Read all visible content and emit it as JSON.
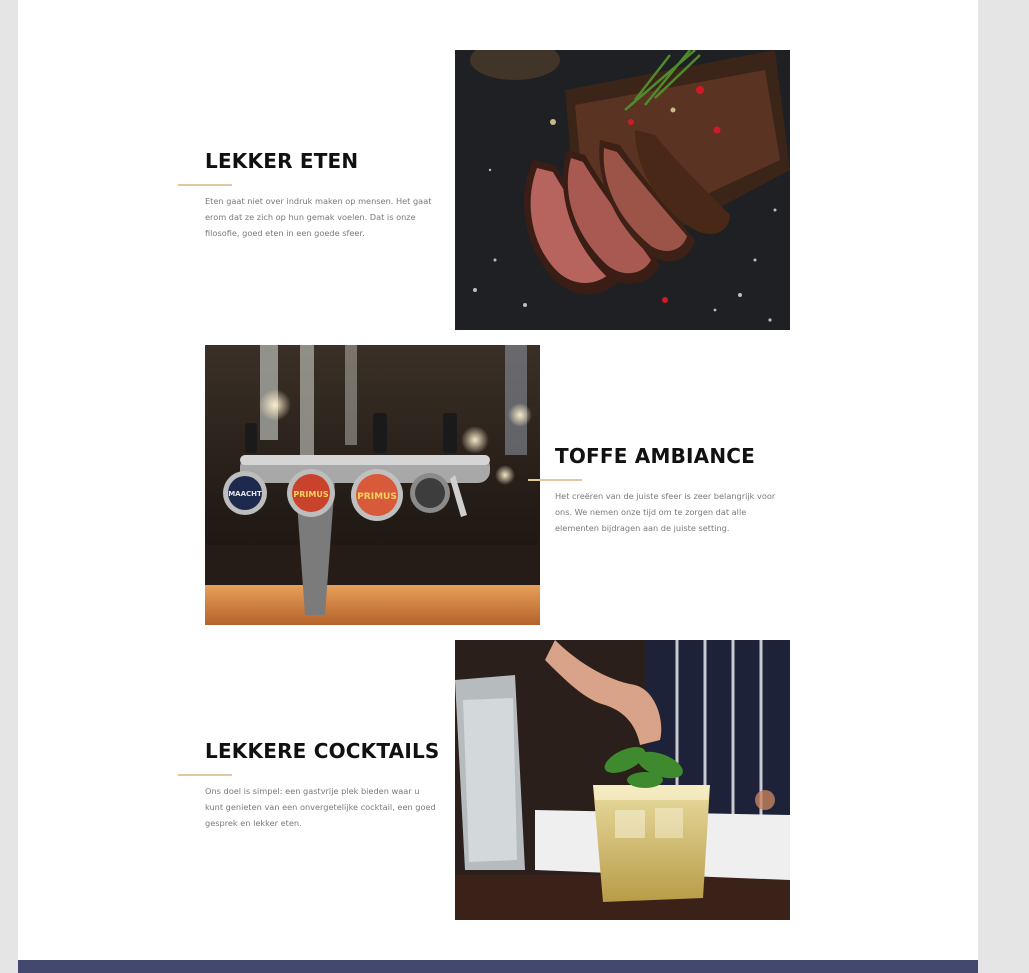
{
  "colors": {
    "page_background": "#e5e5e5",
    "content_background": "#ffffff",
    "accent_line": "#e2c89f",
    "footer_bar": "#43496e",
    "heading": "#111111",
    "body_text": "#7a7a7a"
  },
  "sections": [
    {
      "title": "LEKKER ETEN",
      "description": "Eten gaat niet over indruk maken op mensen. Het gaat erom dat ze zich op hun gemak voelen. Dat is onze filosofie, goed eten in een goede sfeer.",
      "image_icon": "steak-photo"
    },
    {
      "title": "TOFFE AMBIANCE",
      "description": "Het creëren van de juiste sfeer is zeer belangrijk voor ons. We nemen onze tijd om te zorgen dat alle elementen bijdragen aan de juiste setting.",
      "image_icon": "beer-taps-photo",
      "tap_labels": [
        "MAACHT",
        "PRIMUS",
        "PRIMUS"
      ]
    },
    {
      "title": "LEKKERE COCKTAILS",
      "description": "Ons doel is simpel: een gastvrije plek bieden waar u kunt genieten van een onvergetelijke cocktail, een goed gesprek en lekker eten.",
      "image_icon": "cocktail-photo"
    }
  ]
}
